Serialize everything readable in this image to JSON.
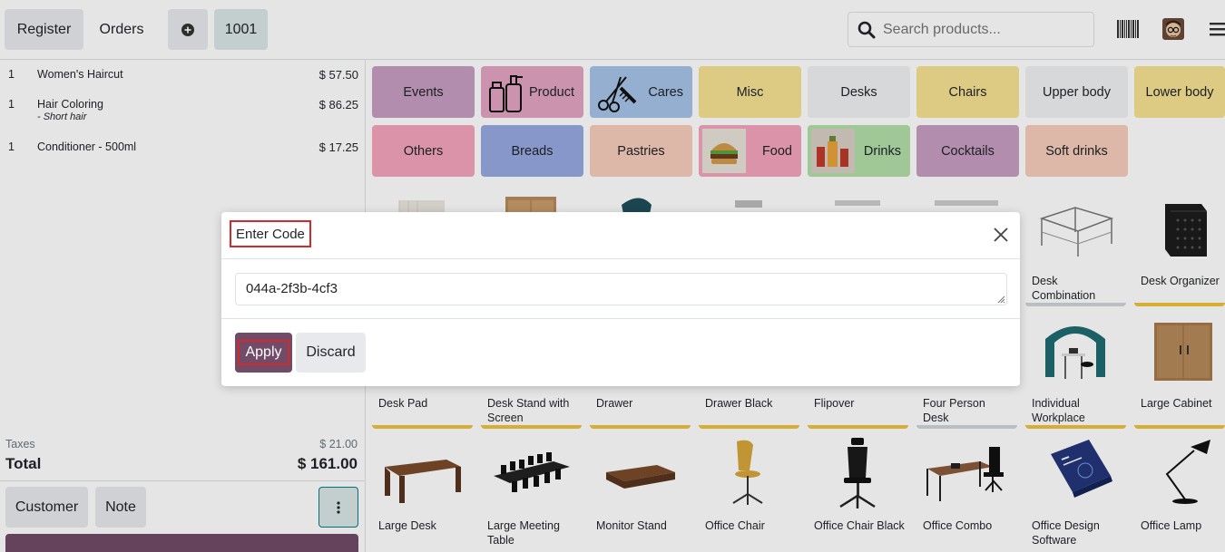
{
  "topbar": {
    "register_label": "Register",
    "orders_label": "Orders",
    "order_number": "1001",
    "search_placeholder": "Search products..."
  },
  "order_lines": [
    {
      "qty": "1",
      "name": "Women's Haircut",
      "note": "",
      "price": "$ 57.50"
    },
    {
      "qty": "1",
      "name": "Hair Coloring",
      "note": "- Short hair",
      "price": "$ 86.25"
    },
    {
      "qty": "1",
      "name": "Conditioner - 500ml",
      "note": "",
      "price": "$ 17.25"
    }
  ],
  "summary": {
    "taxes_label": "Taxes",
    "taxes_value": "$ 21.00",
    "total_label": "Total",
    "total_value": "$ 161.00"
  },
  "actions": {
    "customer_label": "Customer",
    "note_label": "Note"
  },
  "categories": [
    {
      "label": "Events",
      "color": "#c79dc2"
    },
    {
      "label": "Product",
      "color": "#e2a4c1"
    },
    {
      "label": "Cares",
      "color": "#a6c3e8"
    },
    {
      "label": "Misc",
      "color": "#f6e392"
    },
    {
      "label": "Desks",
      "color": "#f0f1f3"
    },
    {
      "label": "Chairs",
      "color": "#f6e392"
    },
    {
      "label": "Upper body",
      "color": "#f0f1f3"
    },
    {
      "label": "Lower body",
      "color": "#f6e392"
    },
    {
      "label": "Others",
      "color": "#f3a4bd"
    },
    {
      "label": "Breads",
      "color": "#98a9e0"
    },
    {
      "label": "Pastries",
      "color": "#f6ccbb"
    },
    {
      "label": "Food",
      "color": "#f3a4bd"
    },
    {
      "label": "Drinks",
      "color": "#b1dfa8"
    },
    {
      "label": "Cocktails",
      "color": "#c79dc2"
    },
    {
      "label": "Soft drinks",
      "color": "#f6ccbb"
    }
  ],
  "products": [
    {
      "name": ""
    },
    {
      "name": ""
    },
    {
      "name": ""
    },
    {
      "name": ""
    },
    {
      "name": ""
    },
    {
      "name": ""
    },
    {
      "name": "Desk Combination"
    },
    {
      "name": "Desk Organizer"
    },
    {
      "name": "Desk Pad"
    },
    {
      "name": "Desk Stand with Screen"
    },
    {
      "name": "Drawer"
    },
    {
      "name": "Drawer Black"
    },
    {
      "name": "Flipover"
    },
    {
      "name": "Four Person Desk"
    },
    {
      "name": "Individual Workplace"
    },
    {
      "name": "Large Cabinet"
    },
    {
      "name": "Large Desk"
    },
    {
      "name": "Large Meeting Table"
    },
    {
      "name": "Monitor Stand"
    },
    {
      "name": "Office Chair"
    },
    {
      "name": "Office Chair Black"
    },
    {
      "name": "Office Combo"
    },
    {
      "name": "Office Design Software"
    },
    {
      "name": "Office Lamp"
    }
  ],
  "dialog": {
    "title": "Enter Code",
    "code_value": "044a-2f3b-4cf3",
    "apply_label": "Apply",
    "discard_label": "Discard"
  },
  "colors": {
    "primary": "#714b67",
    "secondary_bg": "#e7e9ed",
    "teal": "#017e84",
    "highlight": "#d22a2a",
    "stock_bar": "#f0c23a"
  }
}
